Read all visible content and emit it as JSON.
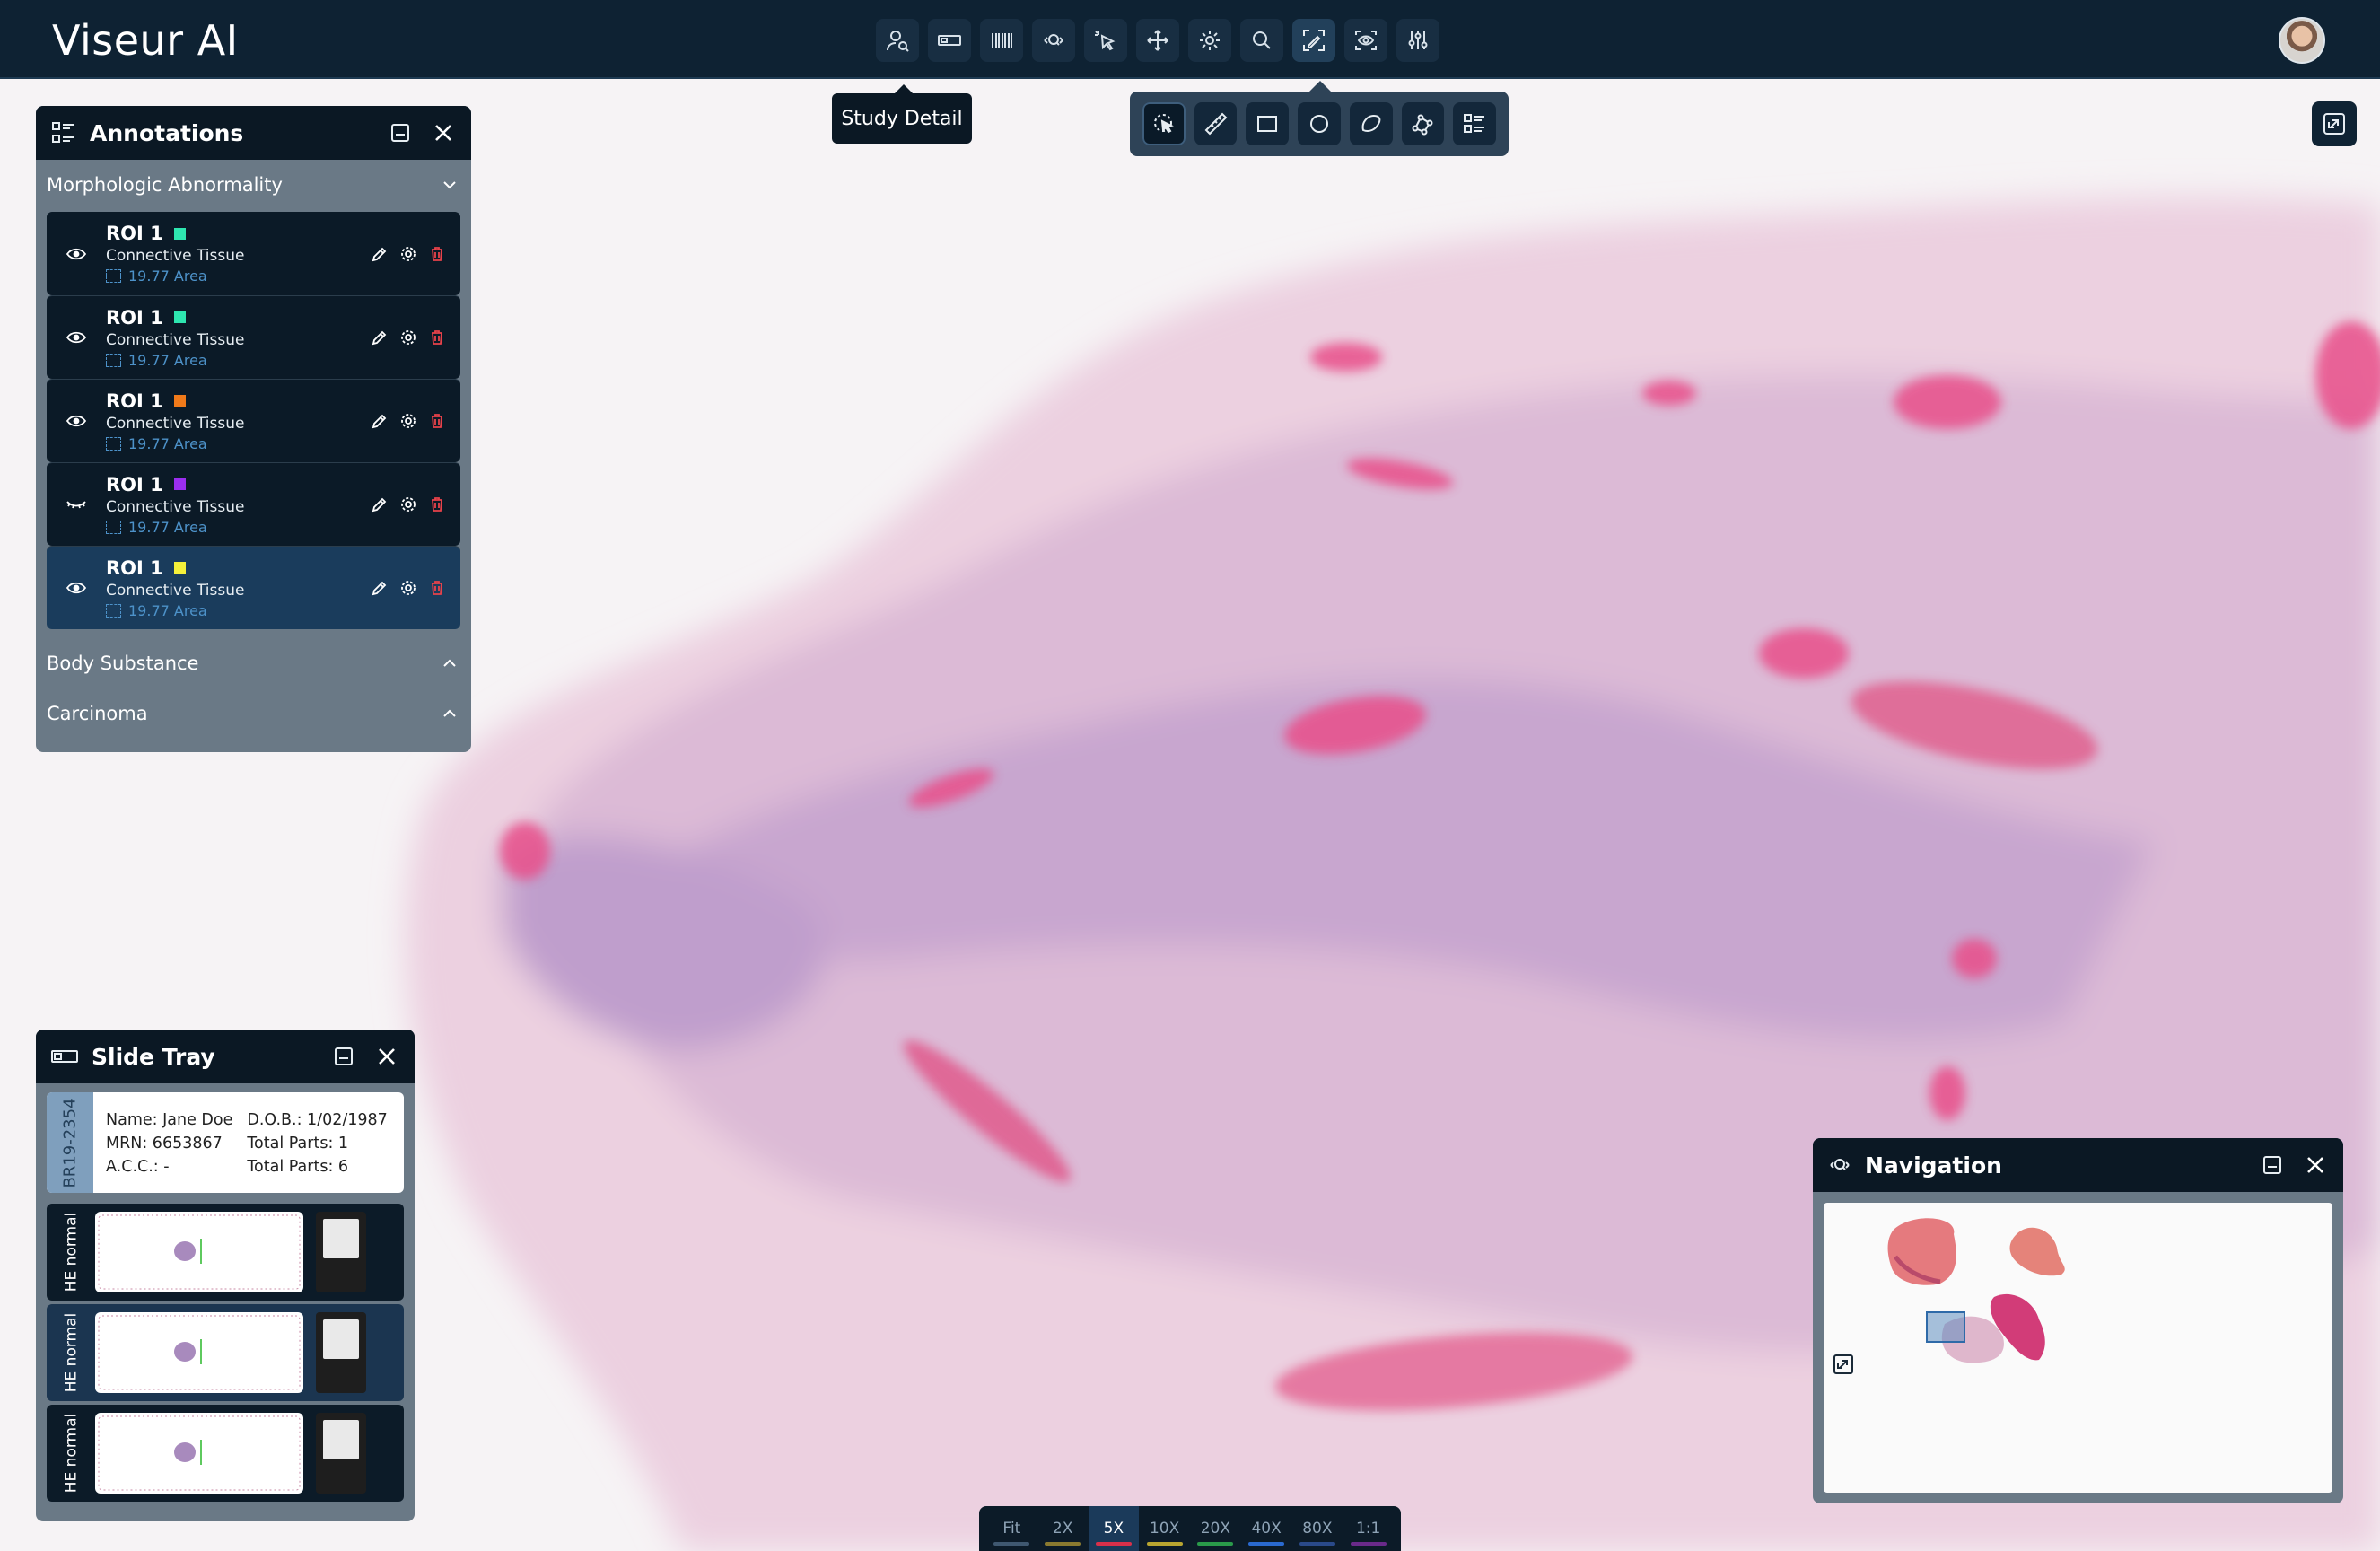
{
  "app": {
    "title": "Viseur AI"
  },
  "toolbar": {
    "tools": [
      "user-search-icon",
      "slide-icon",
      "barcode-icon",
      "zoom-search-icon",
      "pointer-icon",
      "move-icon",
      "brightness-icon",
      "search-icon",
      "annotate-icon",
      "eye-scan-icon",
      "adjust-sliders-icon"
    ],
    "active_tool": 8,
    "tooltip": "Study Detail"
  },
  "annotation_tools": [
    "select-pointer-icon",
    "ruler-icon",
    "rectangle-icon",
    "circle-icon",
    "freehand-icon",
    "polygon-icon",
    "list-icon"
  ],
  "annotations": {
    "title": "Annotations",
    "groups": [
      {
        "name": "Morphologic Abnormality",
        "expanded": true,
        "items": [
          {
            "label": "ROI 1",
            "color": "#2ee6b0",
            "type": "Connective Tissue",
            "area": "19.77 Area",
            "visible": true
          },
          {
            "label": "ROI 1",
            "color": "#2ee6b0",
            "type": "Connective Tissue",
            "area": "19.77 Area",
            "visible": true
          },
          {
            "label": "ROI 1",
            "color": "#f07a1a",
            "type": "Connective Tissue",
            "area": "19.77 Area",
            "visible": true
          },
          {
            "label": "ROI 1",
            "color": "#9b2ef0",
            "type": "Connective Tissue",
            "area": "19.77 Area",
            "visible": false
          },
          {
            "label": "ROI 1",
            "color": "#f5f03a",
            "type": "Connective Tissue",
            "area": "19.77 Area",
            "visible": true,
            "selected": true
          }
        ]
      },
      {
        "name": "Body Substance",
        "expanded": false
      },
      {
        "name": "Carcinoma",
        "expanded": false
      }
    ]
  },
  "slide_tray": {
    "title": "Slide Tray",
    "case_id": "BR19-2354",
    "patient": {
      "name": "Name: Jane Doe",
      "mrn": "MRN: 6653867",
      "acc": "A.C.C.: -",
      "dob": "D.O.B.: 1/02/1987",
      "total_parts": "Total Parts: 1",
      "total_parts_2": "Total Parts: 6"
    },
    "slides": [
      {
        "label": "HE normal"
      },
      {
        "label": "HE normal",
        "selected": true
      },
      {
        "label": "HE normal"
      }
    ]
  },
  "navigation": {
    "title": "Navigation"
  },
  "zoom": {
    "levels": [
      {
        "label": "Fit",
        "color": "#3f5870"
      },
      {
        "label": "2X",
        "color": "#8a7a30"
      },
      {
        "label": "5X",
        "color": "#d9304a"
      },
      {
        "label": "10X",
        "color": "#b8a530"
      },
      {
        "label": "20X",
        "color": "#2a9a4a"
      },
      {
        "label": "40X",
        "color": "#2a6ad0"
      },
      {
        "label": "80X",
        "color": "#2a4a8a"
      },
      {
        "label": "1:1",
        "color": "#6a2a8a"
      }
    ],
    "active": 2
  }
}
